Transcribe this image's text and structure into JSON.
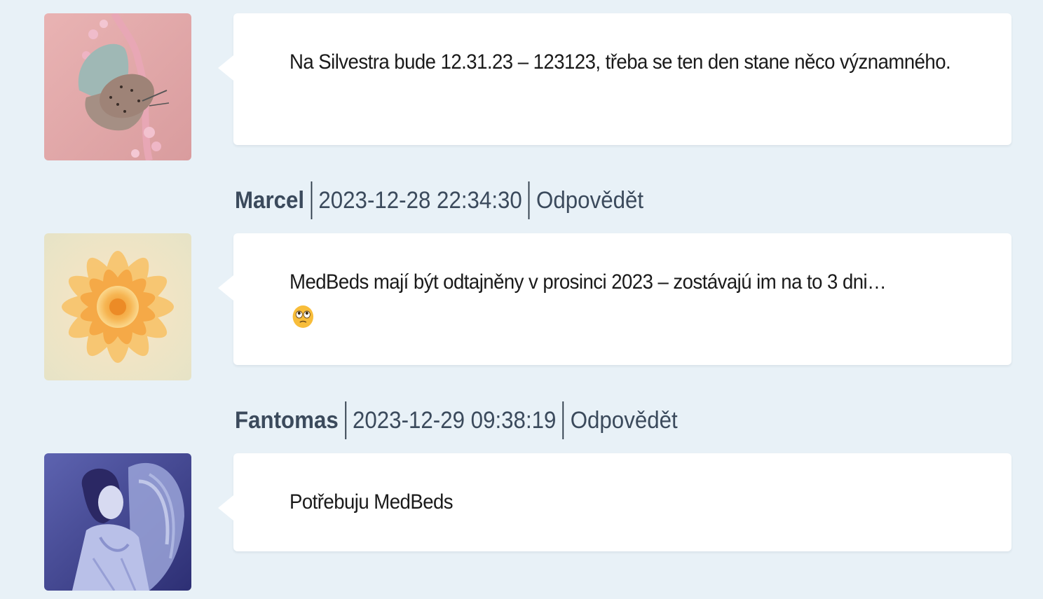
{
  "comments": [
    {
      "avatar": "butterfly-avatar",
      "text": "Na Silvestra bude 12.31.23 – 123123, třeba se ten den stane něco významného."
    },
    {
      "author": "Marcel",
      "date": "2023-12-28 22:34:30",
      "reply": "Odpovědět",
      "avatar": "flower-avatar",
      "text": "MedBeds mají být odtajněny v prosinci 2023 – zostávajú im na to 3 dni…",
      "emoji": "rolling-eyes-emoji"
    },
    {
      "author": "Fantomas",
      "date": "2023-12-29 09:38:19",
      "reply": "Odpovědět",
      "avatar": "angel-avatar",
      "text": "Potřebuju MedBeds"
    }
  ],
  "colors": {
    "background": "#e8f1f7",
    "card": "#ffffff",
    "meta_text": "#3b4a5c"
  }
}
